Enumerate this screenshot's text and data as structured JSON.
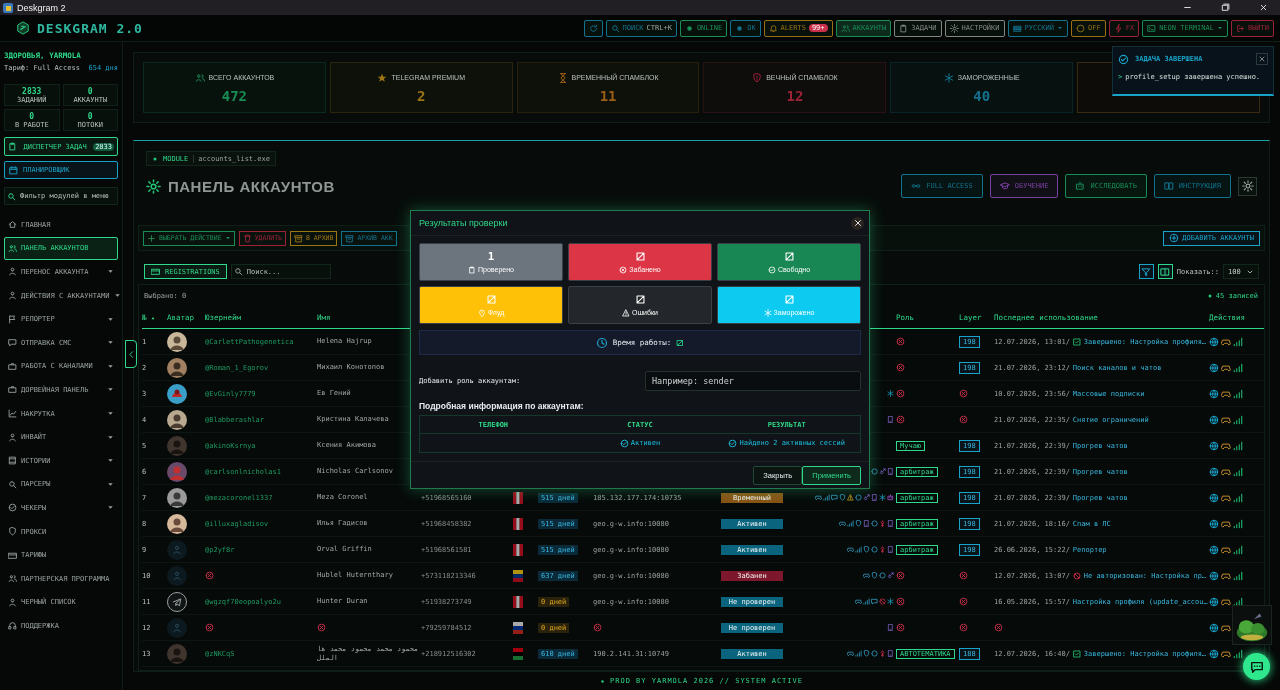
{
  "window": {
    "title": "Deskgram 2"
  },
  "header": {
    "logo": "DESKGRAM 2.0",
    "nav": [
      {
        "color": "#12728d"
      },
      {
        "label": "ПОИСК",
        "hint": "CTRL+K",
        "color": "#12728d"
      },
      {
        "label": "ONLINE",
        "color": "#188d55"
      },
      {
        "label": "OK",
        "color": "#12728d"
      },
      {
        "label": "ALERTS",
        "badge": "99+",
        "color": "#967212"
      },
      {
        "label": "АККАУНТЫ",
        "color": "#188d55",
        "selected": true
      },
      {
        "label": "ЗАДАЧИ",
        "color": "#818683",
        "selected": false
      },
      {
        "label": "НАСТРОЙКИ",
        "color": "#818683",
        "selected": false
      },
      {
        "label": "РУССКИЙ",
        "color": "#12728d",
        "dropdown": true
      },
      {
        "label": "OFF",
        "color": "#967212"
      },
      {
        "label": "FX",
        "color": "#9d2237"
      },
      {
        "label": "NEON TERMINAL",
        "color": "#188d55",
        "dropdown": true
      },
      {
        "label": "ВЫЙТИ",
        "color": "#9d2237"
      }
    ]
  },
  "sidebar": {
    "greeting": "ЗДОРОВЬЯ, YARMOLA",
    "tariff": "Тариф: Full Access",
    "days": "654 дня",
    "stats": [
      {
        "value": "2833",
        "label": "ЗАДАНИЙ"
      },
      {
        "value": "0",
        "label": "АККАУНТЫ"
      },
      {
        "value": "0",
        "label": "В РАБОТЕ"
      },
      {
        "value": "0",
        "label": "ПОТОКИ"
      }
    ],
    "task_manager": {
      "label": "ДИСПЕТЧЕР ЗАДАЧ",
      "badge": "2833"
    },
    "scheduler": {
      "label": "ПЛАНИРОВЩИК"
    },
    "filter": {
      "placeholder": "Фильтр модулей в меню"
    },
    "menu": [
      {
        "label": "ГЛАВНАЯ",
        "selected": false,
        "expandable": false
      },
      {
        "label": "ПАНЕЛЬ АККАУНТОВ",
        "selected": true,
        "expandable": false
      },
      {
        "label": "ПЕРЕНОС АККАУНТА",
        "selected": false,
        "expandable": true
      },
      {
        "label": "ДЕЙСТВИЯ С АККАУНТАМИ",
        "selected": false,
        "expandable": true
      },
      {
        "label": "РЕПОРТЕР",
        "selected": false,
        "expandable": true
      },
      {
        "label": "ОТПРАВКА СМС",
        "selected": false,
        "expandable": true
      },
      {
        "label": "РАБОТА С КАНАЛАМИ",
        "selected": false,
        "expandable": true
      },
      {
        "label": "ДОРВЕЙНАЯ ПАНЕЛЬ",
        "selected": false,
        "expandable": true
      },
      {
        "label": "НАКРУТКА",
        "selected": false,
        "expandable": true
      },
      {
        "label": "ИНВАЙТ",
        "selected": false,
        "expandable": true
      },
      {
        "label": "ИСТОРИИ",
        "selected": false,
        "expandable": true
      },
      {
        "label": "ПАРСЕРЫ",
        "selected": false,
        "expandable": true
      },
      {
        "label": "ЧЕКЕРЫ",
        "selected": false,
        "expandable": true
      },
      {
        "label": "ПРОКСИ",
        "selected": false,
        "expandable": false
      },
      {
        "label": "ТАРИФЫ",
        "selected": false,
        "expandable": false
      },
      {
        "label": "ПАРТНЕРСКАЯ ПРОГРАММА",
        "selected": false,
        "expandable": false
      },
      {
        "label": "ЧЕРНЫЙ СПИСОК",
        "selected": false,
        "expandable": false
      },
      {
        "label": "ПОДДЕРЖКА",
        "selected": false,
        "expandable": false
      }
    ]
  },
  "stat_cards": [
    {
      "title": "ВСЕГО АККАУНТОВ",
      "value": "472",
      "color": "#188d55"
    },
    {
      "title": "TELEGRAM PREMIUM",
      "value": "2",
      "color": "#9d7614"
    },
    {
      "title": "ВРЕМЕННЫЙ СПАМБЛОК",
      "value": "11",
      "color": "#9d5e14"
    },
    {
      "title": "ВЕЧНЫЙ СПАМБЛОК",
      "value": "12",
      "color": "#9d2237"
    },
    {
      "title": "ЗАМОРОЖЕННЫЕ",
      "value": "40",
      "color": "#12728d"
    }
  ],
  "toast": {
    "title": "ЗАДАЧА ЗАВЕРШЕНА",
    "prompt": ">",
    "message": "profile_setup завершена успешно."
  },
  "panel": {
    "module_tag": "MODULE",
    "module_file": "accounts_list.exe",
    "title": "ПАНЕЛЬ АККАУНТОВ",
    "buttons": [
      {
        "label": "FULL ACCESS",
        "color": "#12728d"
      },
      {
        "label": "ОБУЧЕНИЕ",
        "color": "#7b3fa1"
      },
      {
        "label": "ИССЛЕДОВАТЬ",
        "color": "#188d55"
      },
      {
        "label": "ИНСТРУКЦИЯ",
        "color": "#12728d"
      }
    ],
    "actions": [
      {
        "label": "ВЫБРАТЬ ДЕЙСТВИЕ",
        "color": "#188d55",
        "dropdown": true
      },
      {
        "label": "УДАЛИТЬ",
        "color": "#9d2237"
      },
      {
        "label": "В АРХИВ",
        "color": "#9d7614"
      },
      {
        "label": "АРХИВ АКК",
        "color": "#12728d"
      }
    ],
    "add_button": "ДОБАВИТЬ АККАУНТЫ",
    "registrations": "REGISTRATIONS",
    "search_placeholder": "Поиск...",
    "show_label": "Показать::",
    "show_value": "100",
    "selected_count": "Выбрано: 0",
    "records": "45 записей"
  },
  "table": {
    "columns_left": [
      "№",
      "Аватар",
      "Юзернейм",
      "Имя"
    ],
    "columns_right": [
      "Роль",
      "Layer",
      "Последнее использование",
      "Действия"
    ],
    "rows": [
      {
        "num": "1",
        "username": "@CarlettPathogenetica",
        "name": "Helena Hajrup",
        "layer": "198",
        "last_date": "12.07.2026, 13:01/",
        "last_text": "Завершено: Настройка профиля…"
      },
      {
        "num": "2",
        "username": "@Roman_1_Egorov",
        "name": "Михаил Конотопов",
        "layer": "198",
        "last_date": "21.07.2026, 23:12/",
        "last_text": "Поиск каналов и чатов"
      },
      {
        "num": "3",
        "username": "@EvGinly7779",
        "name": "Ев Гений",
        "last_date": "10.07.2026, 23:56/",
        "last_text": "Массовые подписки"
      },
      {
        "num": "4",
        "username": "@Blabberashlar",
        "name": "Кристина Калачева",
        "last_date": "21.07.2026, 22:35/",
        "last_text": "Снятие ограничений"
      },
      {
        "num": "5",
        "username": "@akinoKsrnya",
        "name": "Ксения Акимова",
        "role": "Мучаю",
        "layer": "198",
        "last_date": "21.07.2026, 22:39/",
        "last_text": "Прогрев чатов"
      },
      {
        "num": "6",
        "username": "@carlsonlnicholas1",
        "name": "Nicholas Carlsonov",
        "role": "арбитраж",
        "layer": "198",
        "last_date": "21.07.2026, 22:39/",
        "last_text": "Прогрев чатов"
      },
      {
        "num": "7",
        "username": "@mezacoronel1337",
        "name": "Meza Coronel",
        "phone": "+51968565160",
        "days": "515 дней",
        "proxy": "185.132.177.174:10735",
        "status": {
          "label": "Временный",
          "color": "#885314"
        },
        "role": "арбитраж",
        "layer": "198",
        "last_date": "21.07.2026, 22:39/",
        "last_text": "Прогрев чатов"
      },
      {
        "num": "8",
        "username": "@illuxagladisov",
        "name": "Илья Гадисов",
        "phone": "+51968458382",
        "days": "515 дней",
        "proxy": "geo.g-w.info:10080",
        "status": {
          "label": "Активен",
          "color": "#0a647d"
        },
        "role": "арбитраж",
        "layer": "198",
        "last_date": "21.07.2026, 18:16/",
        "last_text": "Спам в ЛС"
      },
      {
        "num": "9",
        "username": "@p2yf8r",
        "name": "Orval Griffin",
        "phone": "+51968561581",
        "days": "515 дней",
        "proxy": "geo.g-w.info:10080",
        "status": {
          "label": "Активен",
          "color": "#0a647d"
        },
        "role": "арбитраж",
        "layer": "198",
        "last_date": "26.06.2026, 15:22/",
        "last_text": "Репортер"
      },
      {
        "num": "10",
        "name": "Hublel Huterntharу",
        "phone": "+573118213346",
        "days": "637 дней",
        "proxy": "geo.g-w.info:10080",
        "status": {
          "label": "Забанен",
          "color": "#7d172c"
        },
        "last_date": "12.07.2026, 13:07/",
        "last_text": "Не авторизован: Настройка пр…"
      },
      {
        "num": "11",
        "username": "@wgzqf70eopoalyo2u",
        "name": "Hunter Duran",
        "phone": "+51938273749",
        "days": "0 дней",
        "proxy": "geo.g-w.info:10080",
        "status": {
          "label": "Не проверен",
          "color": "#0a647d"
        },
        "last_date": "16.05.2026, 15:57/",
        "last_text": "Настройка профиля (update_accou…"
      },
      {
        "num": "12",
        "phone": "+79259784512",
        "days": "0 дней",
        "status": {
          "label": "Не проверен",
          "color": "#0a647d"
        }
      },
      {
        "num": "13",
        "username": "@zNKCqS",
        "name": "محمود محمد محمود محمد ها الملل",
        "phone": "+218912516302",
        "days": "610 дней",
        "proxy": "190.2.141.31:10749",
        "status": {
          "label": "Активен",
          "color": "#0a647d"
        },
        "role": "АВТОТЕМАТИКА",
        "layer": "188",
        "last_date": "12.07.2026, 16:40/",
        "last_text": "Завершено: Настройка профиля…"
      }
    ]
  },
  "footer": "PROD BY YARMOLA 2026 // SYSTEM ACTIVE",
  "modal": {
    "title": "Результаты проверки",
    "tiles": [
      {
        "value": "1",
        "label": "Проверено",
        "color": "#6c757d"
      },
      {
        "label": "Забанено",
        "color": "#dc3545"
      },
      {
        "label": "Свободно",
        "color": "#198754"
      },
      {
        "label": "Флуд",
        "color": "#ffc107"
      },
      {
        "label": "Ошибки",
        "color": "#23262a"
      },
      {
        "label": "Заморожено",
        "color": "#0dcaf0"
      }
    ],
    "runtime_label": "Время работы:",
    "role_label": "Добавить роль аккаунтам:",
    "role_placeholder": "Например: sender",
    "details_title": "Подробная информация по аккаунтам:",
    "columns": [
      "ТЕЛЕФОН",
      "СТАТУС",
      "РЕЗУЛЬТАТ"
    ],
    "rows": [
      {
        "status": "Активен",
        "result": "Найдено 2 активных сессий"
      }
    ],
    "buttons": [
      {
        "label": "Закрыть",
        "primary": false
      },
      {
        "label": "Применить",
        "primary": true
      }
    ]
  }
}
